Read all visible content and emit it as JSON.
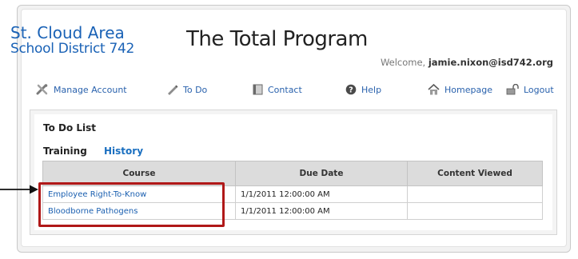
{
  "header": {
    "logo_line1": "St. Cloud Area",
    "logo_line2": "School District 742",
    "title": "The Total Program",
    "welcome_prefix": "Welcome,",
    "welcome_user": "jamie.nixon@isd742.org"
  },
  "nav": {
    "items": [
      {
        "label": "Manage Account",
        "icon": "wrench-screwdriver-icon"
      },
      {
        "label": "To Do",
        "icon": "pencil-icon"
      },
      {
        "label": "Contact",
        "icon": "contact-card-icon"
      },
      {
        "label": "Help",
        "icon": "help-circle-icon"
      },
      {
        "label": "Homepage",
        "icon": "home-icon"
      },
      {
        "label": "Logout",
        "icon": "logout-icon"
      }
    ]
  },
  "todo": {
    "title": "To Do List",
    "tabs": [
      "Training",
      "History"
    ],
    "columns": [
      "Course",
      "Due Date",
      "Content Viewed"
    ],
    "rows": [
      {
        "course": "Employee Right-To-Know",
        "due": "1/1/2011 12:00:00 AM",
        "viewed": ""
      },
      {
        "course": "Bloodborne Pathogens",
        "due": "1/1/2011 12:00:00 AM",
        "viewed": ""
      }
    ]
  },
  "colors": {
    "brand_blue": "#1a62b6",
    "link_blue": "#2a62ad",
    "callout_red": "#b01818",
    "header_gray": "#dcdcdc"
  }
}
